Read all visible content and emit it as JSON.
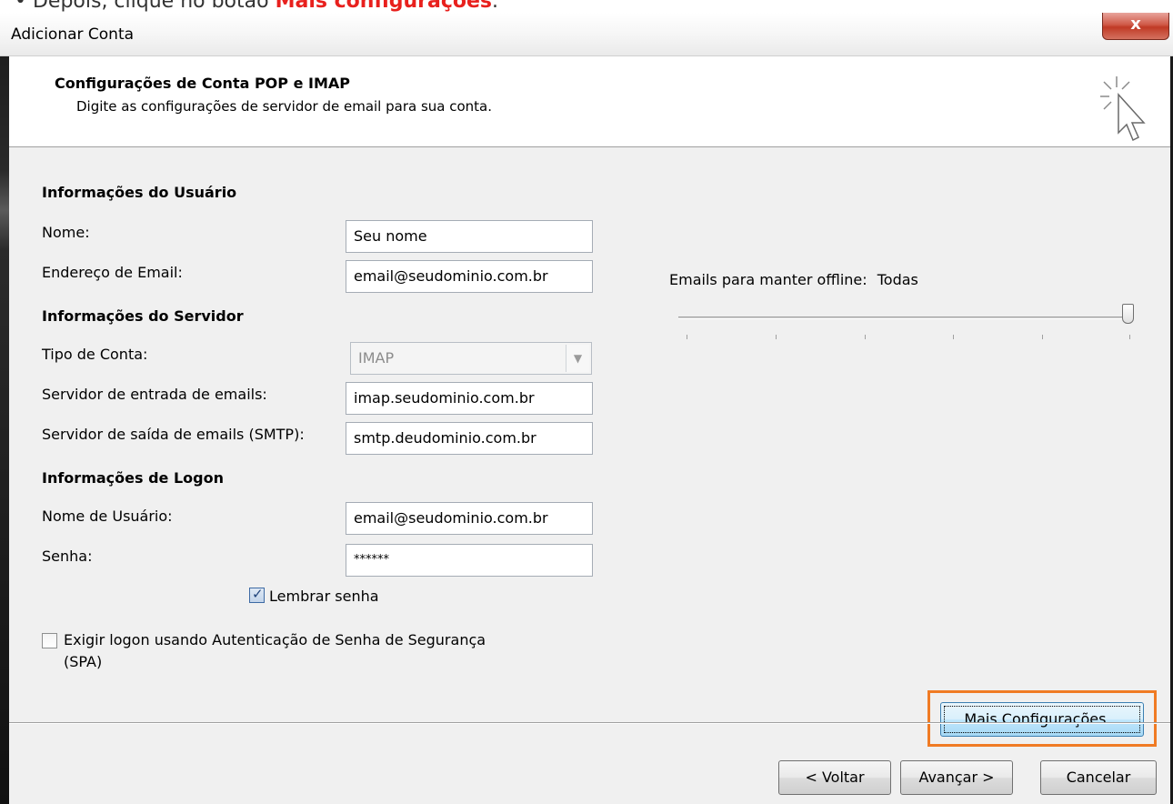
{
  "caption": {
    "prefix": "• Depois, clique no botão ",
    "highlight": "Mais configurações",
    "suffix": "."
  },
  "window": {
    "title": "Adicionar Conta",
    "close_label": "x"
  },
  "header": {
    "title": "Configurações de Conta POP e IMAP",
    "subtitle": "Digite as configurações de servidor de email para sua conta.",
    "icon": "cursor-sparkle-icon"
  },
  "user_info": {
    "section_title": "Informações do Usuário",
    "name_label": "Nome:",
    "name_value": "Seu nome",
    "email_label": "Endereço de Email:",
    "email_value": "email@seudominio.com.br"
  },
  "server_info": {
    "section_title": "Informações do Servidor",
    "account_type_label": "Tipo de Conta:",
    "account_type_value": "IMAP",
    "incoming_label": "Servidor de entrada de emails:",
    "incoming_value": "imap.seudominio.com.br",
    "outgoing_label": "Servidor de saída de emails (SMTP):",
    "outgoing_value": "smtp.deudominio.com.br"
  },
  "logon_info": {
    "section_title": "Informações de Logon",
    "username_label": "Nome de Usuário:",
    "username_value": "email@seudominio.com.br",
    "password_label": "Senha:",
    "password_value": "******",
    "remember_label": "Lembrar senha",
    "remember_checked": true,
    "spa_label_line1": "Exigir logon usando Autenticação de Senha de Segurança",
    "spa_label_line2": "(SPA)",
    "spa_checked": false
  },
  "offline": {
    "label": "Emails para manter offline:",
    "value": "Todas",
    "slider_position": 1.0,
    "tick_count": 6
  },
  "buttons": {
    "more_settings": "Mais Configurações...",
    "back": "< Voltar",
    "next": "Avançar >",
    "cancel": "Cancelar"
  },
  "colors": {
    "highlight_frame": "#f07b24",
    "caption_highlight": "#e8201d",
    "close_button": "#c03a25"
  }
}
